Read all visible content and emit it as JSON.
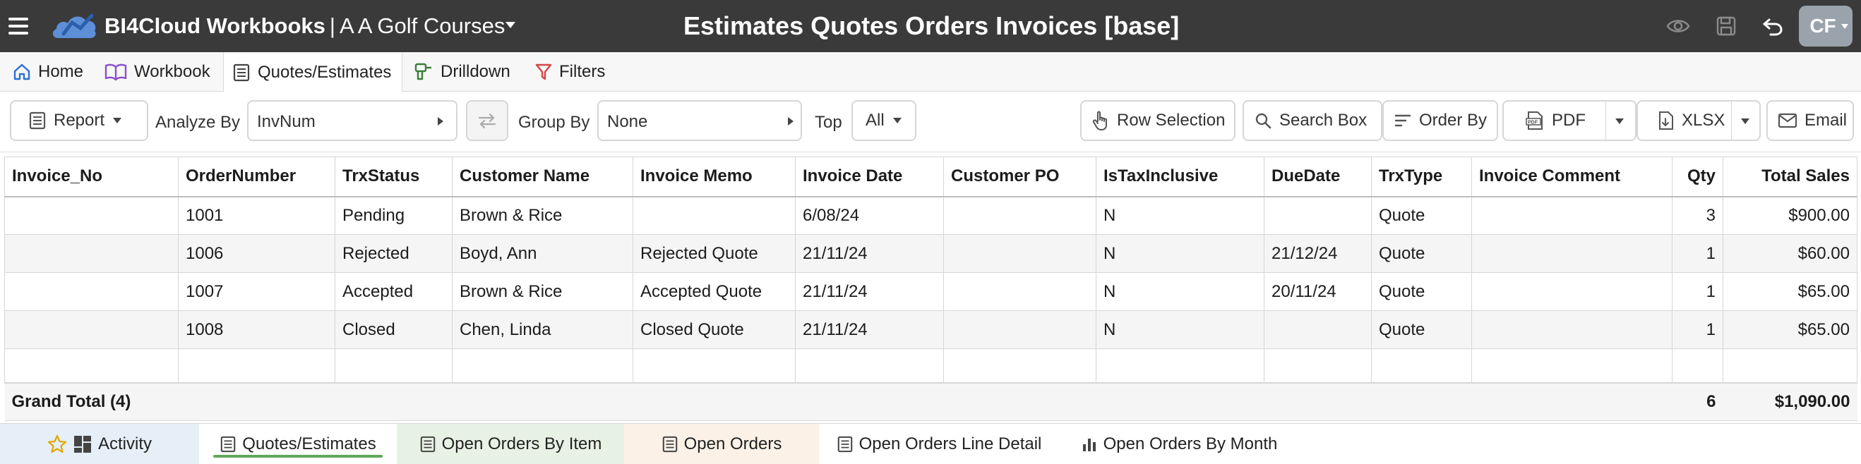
{
  "titlebar": {
    "brand": "BI4Cloud Workbooks",
    "separator": "|",
    "workspace": "A A Golf Courses",
    "page_title": "Estimates Quotes Orders Invoices [base]",
    "avatar_initials": "CF",
    "icons": [
      "eye-icon",
      "save-icon",
      "undo-icon"
    ]
  },
  "menu_tabs": [
    {
      "label": "Home",
      "icon": "home-icon",
      "active": false
    },
    {
      "label": "Workbook",
      "icon": "book-icon",
      "active": false
    },
    {
      "label": "Quotes/Estimates",
      "icon": "report-icon",
      "active": true
    },
    {
      "label": "Drilldown",
      "icon": "drill-icon",
      "active": false
    },
    {
      "label": "Filters",
      "icon": "filter-icon",
      "active": false
    }
  ],
  "toolbar": {
    "report_label": "Report",
    "analyze_by_label": "Analyze By",
    "analyze_by_value": "InvNum",
    "group_by_label": "Group By",
    "group_by_value": "None",
    "top_label": "Top",
    "top_value": "All",
    "row_selection_label": "Row Selection",
    "search_box_label": "Search Box",
    "order_by_label": "Order By",
    "pdf_label": "PDF",
    "xlsx_label": "XLSX",
    "email_label": "Email"
  },
  "table": {
    "columns": [
      "Invoice_No",
      "OrderNumber",
      "TrxStatus",
      "Customer Name",
      "Invoice Memo",
      "Invoice Date",
      "Customer PO",
      "IsTaxInclusive",
      "DueDate",
      "TrxType",
      "Invoice Comment",
      "Qty",
      "Total Sales"
    ],
    "rows": [
      [
        "",
        "1001",
        "Pending",
        "Brown & Rice",
        "",
        "6/08/24",
        "",
        "N",
        "",
        "Quote",
        "",
        "3",
        "$900.00"
      ],
      [
        "",
        "1006",
        "Rejected",
        "Boyd, Ann",
        "Rejected Quote",
        "21/11/24",
        "",
        "N",
        "21/12/24",
        "Quote",
        "",
        "1",
        "$60.00"
      ],
      [
        "",
        "1007",
        "Accepted",
        "Brown & Rice",
        "Accepted Quote",
        "21/11/24",
        "",
        "N",
        "20/11/24",
        "Quote",
        "",
        "1",
        "$65.00"
      ],
      [
        "",
        "1008",
        "Closed",
        "Chen, Linda",
        "Closed Quote",
        "21/11/24",
        "",
        "N",
        "",
        "Quote",
        "",
        "1",
        "$65.00"
      ]
    ],
    "total": {
      "label": "Grand Total (4)",
      "qty": "6",
      "total_sales": "$1,090.00"
    }
  },
  "bottom_tabs": [
    {
      "label": "Activity",
      "bg": "#e6eef7",
      "active": false
    },
    {
      "label": "Quotes/Estimates",
      "bg": "#ffffff",
      "active": true
    },
    {
      "label": "Open Orders By Item",
      "bg": "#e8f2e4",
      "active": false
    },
    {
      "label": "Open Orders",
      "bg": "#fbf1e6",
      "active": false
    },
    {
      "label": "Open Orders Line Detail",
      "bg": "#ffffff",
      "active": false
    },
    {
      "label": "Open Orders By Month",
      "bg": "#ffffff",
      "active": false
    }
  ],
  "colors": {
    "titlebar": "#3a3a3a",
    "accent_blue": "#2f6fd1",
    "filter_red": "#d64545",
    "workbook_purple": "#8a4fd0",
    "drill_green": "#3b7d3b",
    "active_underline": "#5fa85a"
  }
}
